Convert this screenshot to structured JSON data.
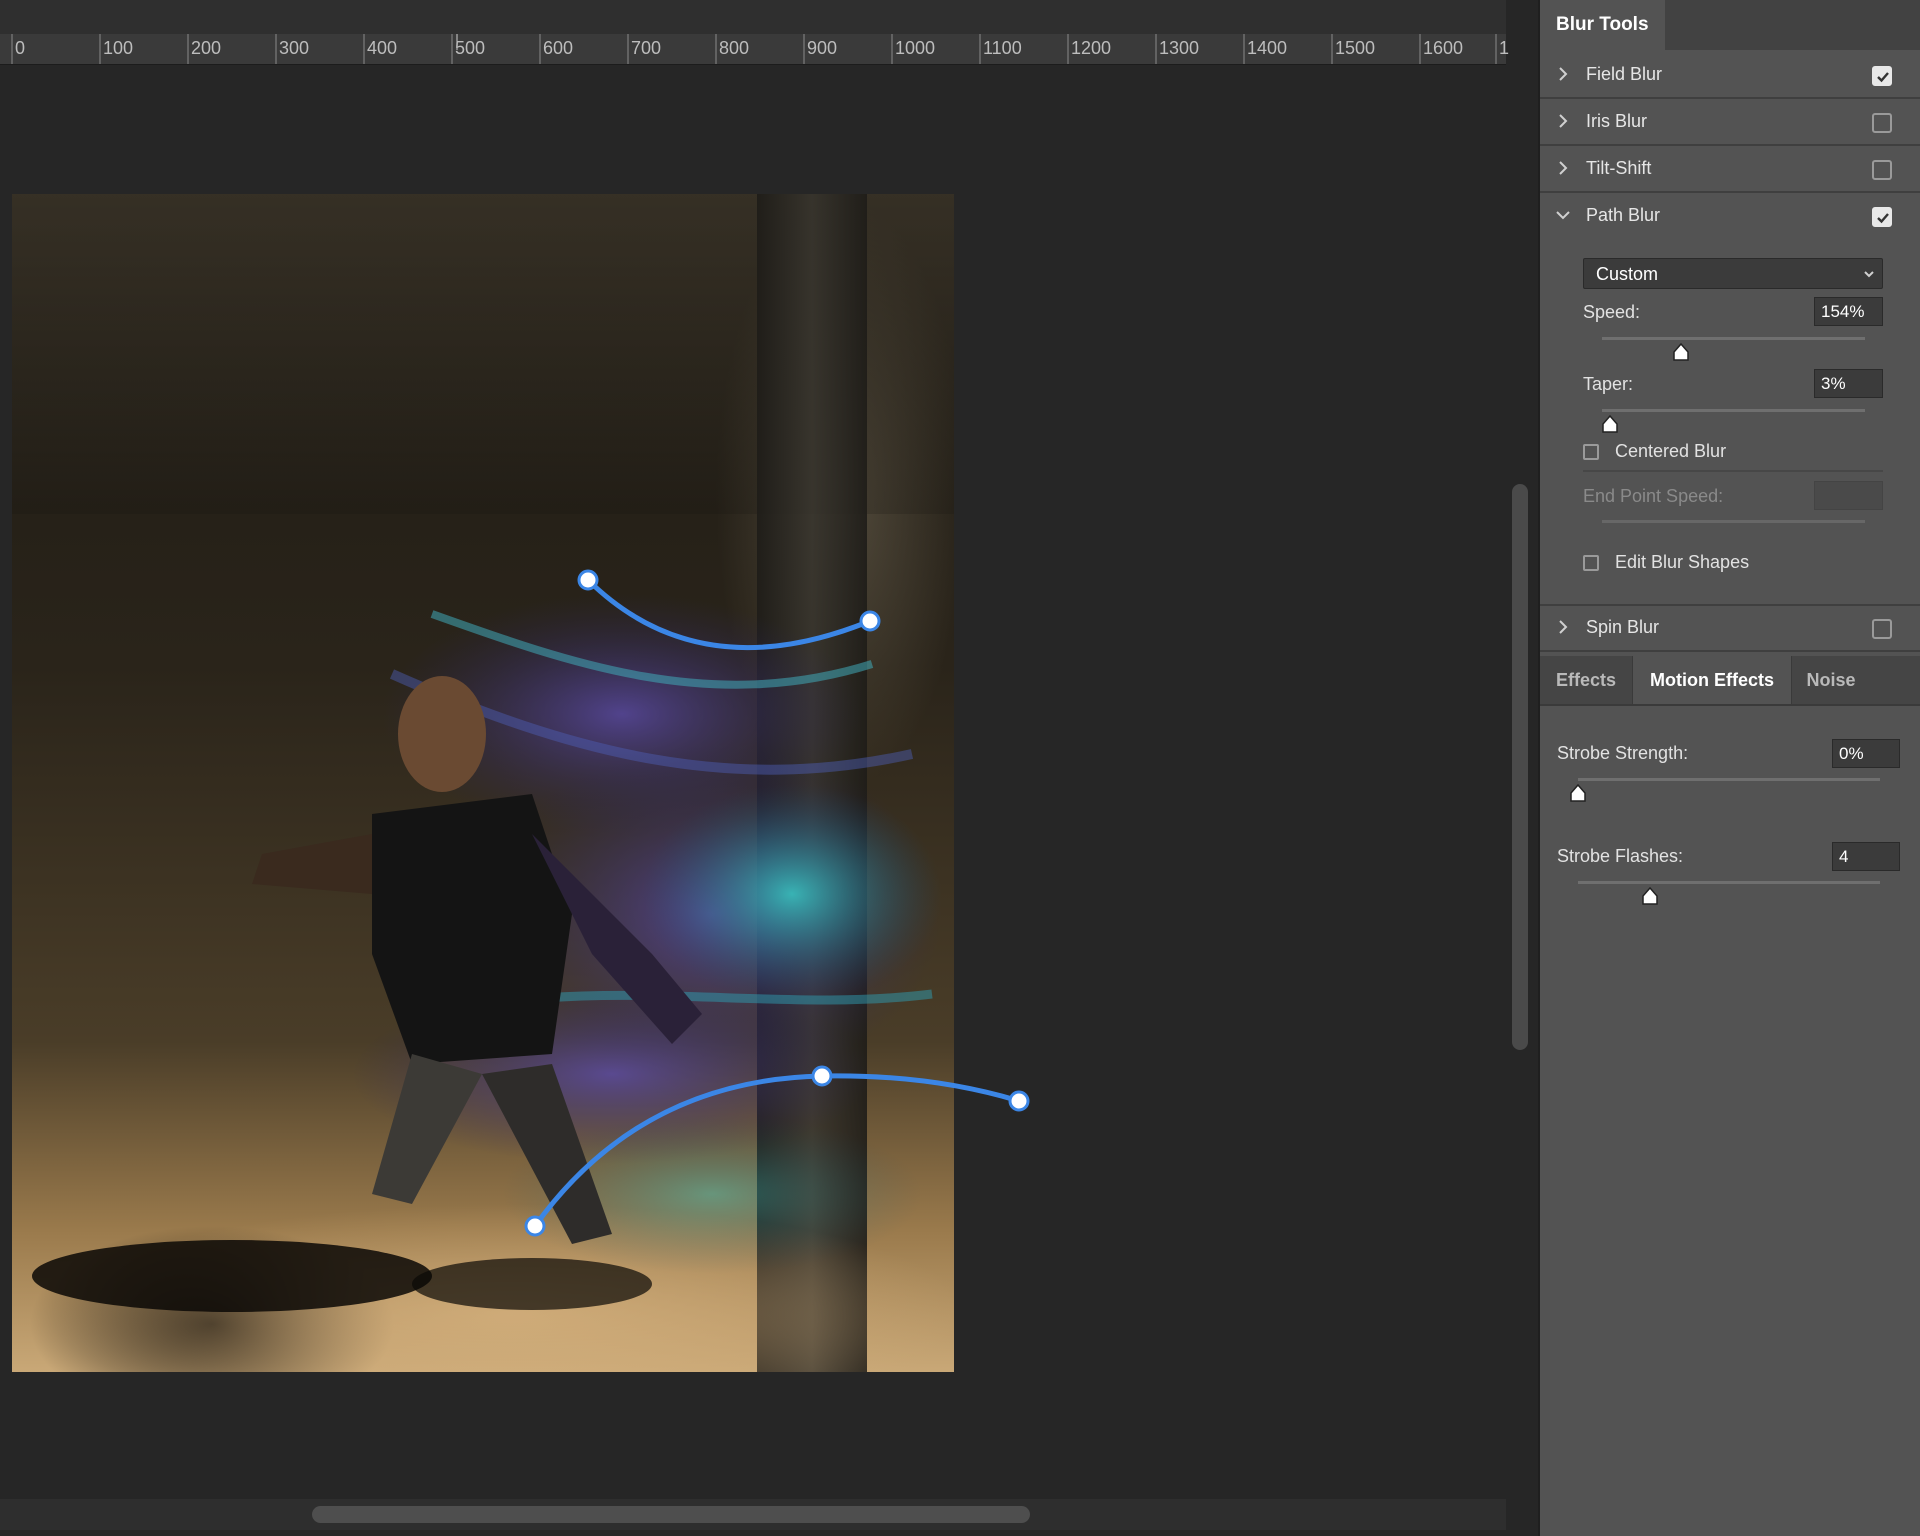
{
  "ruler": {
    "ticks": [
      "0",
      "100",
      "200",
      "300",
      "400",
      "500",
      "600",
      "700",
      "800",
      "900",
      "1000",
      "1100",
      "1200",
      "1300",
      "1400",
      "1500",
      "1600",
      "1"
    ]
  },
  "panel": {
    "title": "Blur Tools",
    "sections": {
      "field_blur": {
        "label": "Field Blur",
        "checked": true
      },
      "iris_blur": {
        "label": "Iris Blur",
        "checked": false
      },
      "tilt_shift": {
        "label": "Tilt-Shift",
        "checked": false
      },
      "path_blur": {
        "label": "Path Blur",
        "checked": true
      },
      "spin_blur": {
        "label": "Spin Blur",
        "checked": false
      }
    },
    "path_blur": {
      "preset": "Custom",
      "speed_label": "Speed:",
      "speed_value": "154%",
      "speed_level": 0.3,
      "taper_label": "Taper:",
      "taper_value": "3%",
      "taper_level": 0.03,
      "centered_blur_label": "Centered Blur",
      "centered_blur_checked": false,
      "end_point_speed_label": "End Point Speed:",
      "end_point_speed_value": "",
      "edit_blur_shapes_label": "Edit Blur Shapes",
      "edit_blur_shapes_checked": false
    },
    "tabs": [
      {
        "label": "Effects",
        "active": false
      },
      {
        "label": "Motion Effects",
        "active": true
      },
      {
        "label": "Noise",
        "active": false
      }
    ],
    "motion_effects": {
      "strobe_strength_label": "Strobe Strength:",
      "strobe_strength_value": "0%",
      "strobe_strength_level": 0.0,
      "strobe_flashes_label": "Strobe Flashes:",
      "strobe_flashes_value": "4",
      "strobe_flashes_level": 0.24
    }
  },
  "colors": {
    "accent_path": "#3b86e6",
    "panel_bg": "#535353",
    "canvas_bg": "#262626"
  }
}
